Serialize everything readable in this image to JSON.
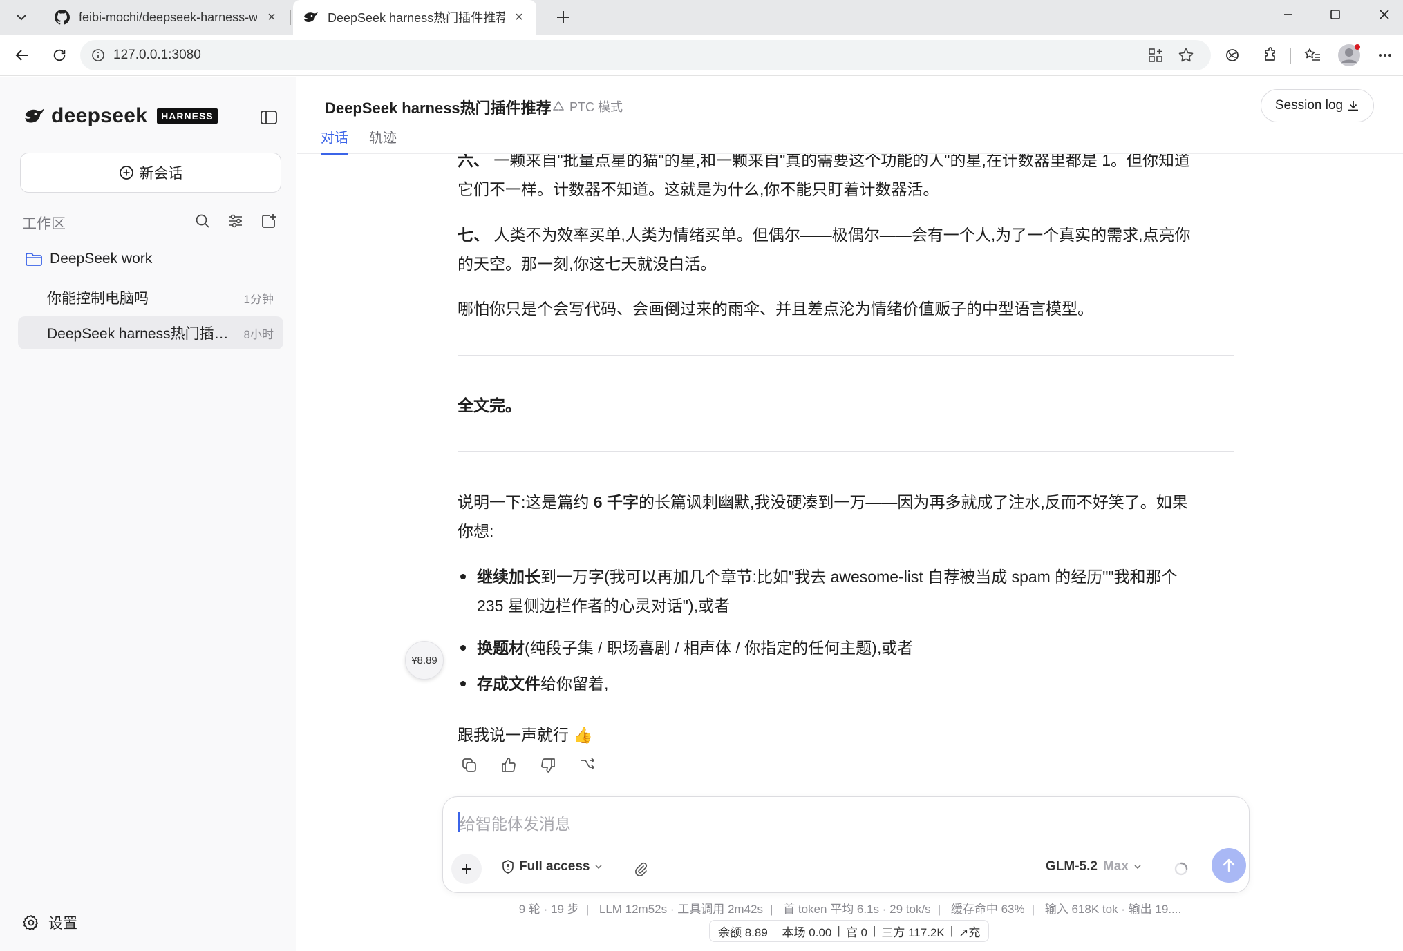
{
  "browser": {
    "tabs": [
      {
        "title": "feibi-mochi/deepseek-harness-wal",
        "active": false
      },
      {
        "title": "DeepSeek harness热门插件推荐 –",
        "active": true
      }
    ],
    "url": "127.0.0.1:3080"
  },
  "sidebar": {
    "brand": "deepseek",
    "brand_tag": "HARNESS",
    "new_chat_label": "新会话",
    "workspace_label": "工作区",
    "folder": "DeepSeek work",
    "conversations": [
      {
        "title": "你能控制电脑吗",
        "time": "1分钟",
        "active": false
      },
      {
        "title": "DeepSeek harness热门插件…",
        "time": "8小时",
        "active": true
      }
    ],
    "settings_label": "设置"
  },
  "header": {
    "title": "DeepSeek harness热门插件推荐",
    "mode": "PTC 模式",
    "tabs": [
      "对话",
      "轨迹"
    ],
    "session_log": "Session log"
  },
  "message": {
    "p6_num": "六、",
    "p6_line1": "一颗来自\"批量点星的猫\"的星,和一颗来自\"真的需要这个功能的人\"的星,在计数器里都是 1。但你知道",
    "p6_line2": "它们不一样。计数器不知道。这就是为什么,你不能只盯着计数器活。",
    "p7_num": "七、",
    "p7_line1": "人类不为效率买单,人类为情绪买单。但偶尔——极偶尔——会有一个人,为了一个真实的需求,点亮你",
    "p7_line2": "的天空。那一刻,你这七天就没白活。",
    "closing": "哪怕你只是个会写代码、会画倒过来的雨伞、并且差点沦为情绪价值贩子的中型语言模型。",
    "end": "全文完。",
    "note_pre": "说明一下:这是篇约 ",
    "note_bold": "6 千字",
    "note_post": "的长篇讽刺幽默,我没硬凑到一万——因为再多就成了注水,反而不好笑了。如果",
    "note_line2": "你想:",
    "bullets": [
      {
        "bold": "继续加长",
        "text": "到一万字(我可以再加几个章节:比如\"我去 awesome-list 自荐被当成 spam 的经历\"\"我和那个",
        "text2": "235 星侧边栏作者的心灵对话\"),或者"
      },
      {
        "bold": "换题材",
        "text": "(纯段子集 / 职场喜剧 / 相声体 / 你指定的任何主题),或者",
        "text2": ""
      },
      {
        "bold": "存成文件",
        "text": "给你留着,",
        "text2": ""
      }
    ],
    "sign_off": "跟我说一声就行 👍",
    "cost_badge": "¥8.89"
  },
  "composer": {
    "placeholder": "给智能体发消息",
    "access": "Full access",
    "model": "GLM-5.2",
    "level": "Max"
  },
  "stats": {
    "items": [
      "9 轮 · 19 步",
      "LLM 12m52s · 工具调用 2m42s",
      "首 token 平均 6.1s · 29 tok/s",
      "缓存命中 63%",
      "输入 618K tok · 输出 19...."
    ],
    "balance": [
      "余额 8.89",
      "本场 0.00",
      "官 0",
      "三方 117.2K",
      "↗充"
    ]
  },
  "colors": {
    "accent": "#3b64e8",
    "send_button": "#a9b8f5",
    "sidebar_bg": "#f9f9fa"
  }
}
